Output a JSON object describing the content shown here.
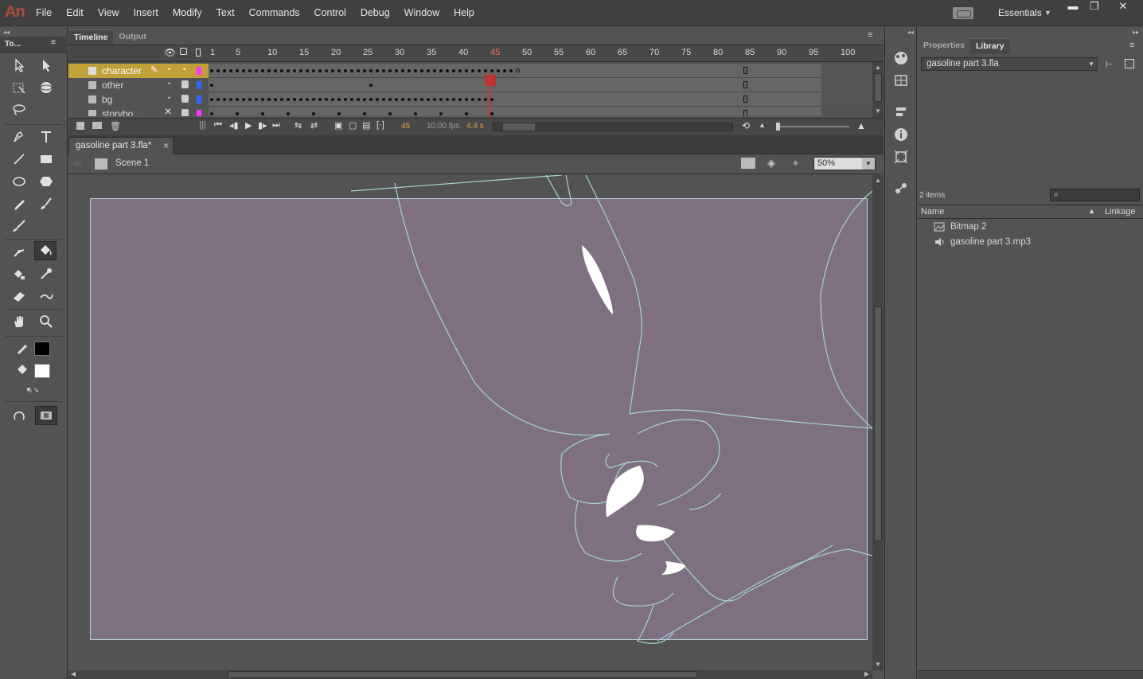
{
  "app": {
    "logo": "An"
  },
  "menu": [
    "File",
    "Edit",
    "View",
    "Insert",
    "Modify",
    "Text",
    "Commands",
    "Control",
    "Debug",
    "Window",
    "Help"
  ],
  "workspace": {
    "label": "Essentials"
  },
  "window_controls": {
    "minimize": "▬",
    "restore": "❐",
    "close": "✕"
  },
  "tools_panel": {
    "title": "To...",
    "icons": [
      "selection-tool",
      "subselection-tool",
      "free-transform-tool",
      "3d-rotation-tool",
      "lasso-tool",
      "pen-tool",
      "text-tool",
      "line-tool",
      "rectangle-tool",
      "oval-tool",
      "polystar-tool",
      "pencil-tool",
      "brush-tool",
      "paint-brush-tool",
      "bone-tool",
      "paint-bucket-tool",
      "bucket-tool",
      "eyedropper-tool",
      "eraser-tool",
      "width-tool",
      "hand-tool",
      "zoom-tool",
      "stroke-color",
      "fill-color",
      "swap-colors",
      "snap-to-objects",
      "smooth-option"
    ],
    "colors": {
      "stroke": "#000000",
      "fill": "#ffffff"
    }
  },
  "timeline": {
    "tabs": [
      "Timeline",
      "Output"
    ],
    "ruler": [
      "1",
      "5",
      "10",
      "15",
      "20",
      "25",
      "30",
      "35",
      "40",
      "45",
      "50",
      "55",
      "60",
      "65",
      "70",
      "75",
      "80",
      "85",
      "90",
      "95",
      "100"
    ],
    "layers": [
      {
        "name": "character",
        "selected": true,
        "color": "#ff33ff"
      },
      {
        "name": "other",
        "selected": false,
        "color": "#3366ff"
      },
      {
        "name": "bg",
        "selected": false,
        "color": "#3366ff"
      },
      {
        "name": "storybo...",
        "selected": false,
        "color": "#ff33ff"
      }
    ],
    "current_frame": "45",
    "fps": "10.00 fps",
    "elapsed": "4.4 s",
    "playhead_frame": 45
  },
  "document": {
    "tab": "gasoline part 3.fla*",
    "close": "×",
    "scene": "Scene 1",
    "zoom": "50%"
  },
  "stage": {
    "color": "#7e7081",
    "border": "#b5d0d7"
  },
  "library": {
    "tabs": [
      "Properties",
      "Library"
    ],
    "document": "gasoline part 3.fla",
    "count": "2 items",
    "columns": {
      "name": "Name",
      "linkage": "Linkage"
    },
    "items": [
      {
        "label": "Bitmap 2",
        "icon": "bitmap-icon"
      },
      {
        "label": "gasoline part 3.mp3",
        "icon": "sound-icon"
      }
    ]
  }
}
